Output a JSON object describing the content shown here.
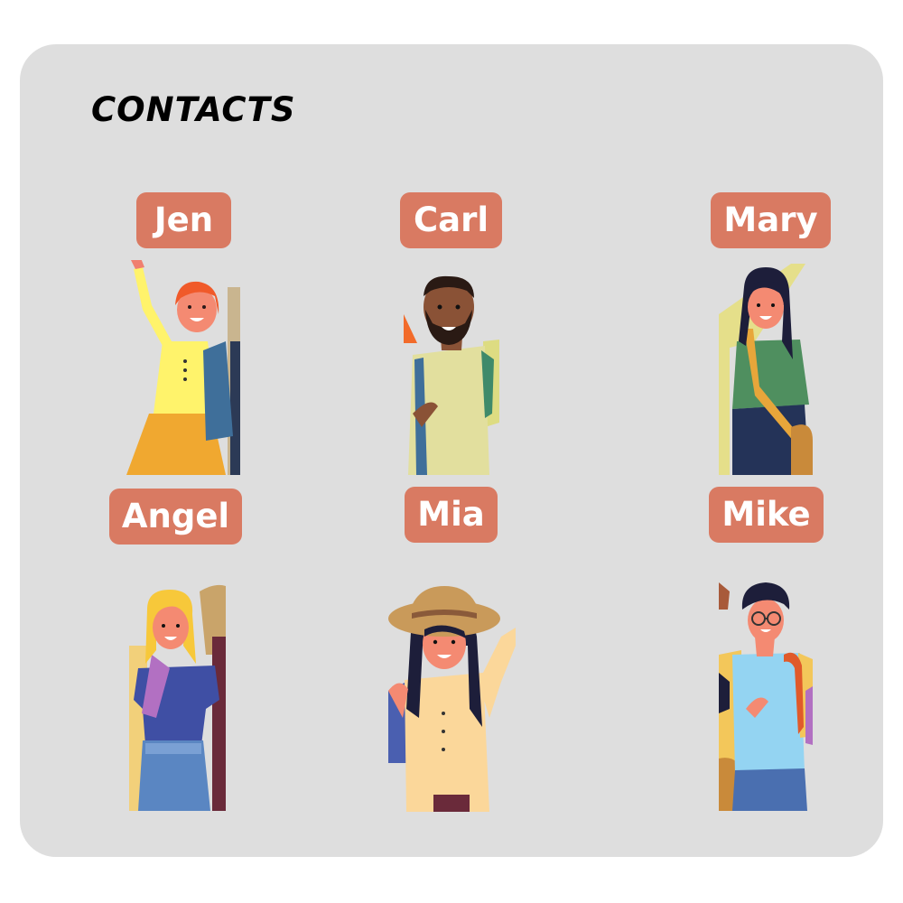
{
  "header": {
    "title": "CONTACTS"
  },
  "contacts": [
    {
      "name": "Jen"
    },
    {
      "name": "Carl"
    },
    {
      "name": "Mary"
    },
    {
      "name": "Angel"
    },
    {
      "name": "Mia"
    },
    {
      "name": "Mike"
    }
  ],
  "colors": {
    "panel": "#dedede",
    "pill": "#d97a62",
    "pill_text": "#ffffff"
  }
}
